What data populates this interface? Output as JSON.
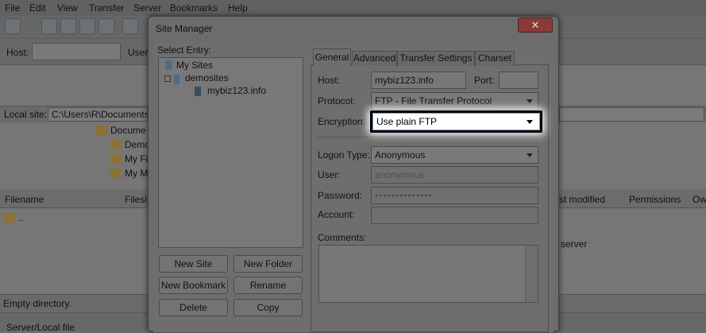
{
  "menubar": {
    "items": [
      "File",
      "Edit",
      "View",
      "Transfer",
      "Server",
      "Bookmarks",
      "Help"
    ]
  },
  "quickconnect": {
    "host_label": "Host:",
    "user_label": "User"
  },
  "local": {
    "site_label": "Local site:",
    "path": "C:\\Users\\R\\Documents\\W",
    "tree_items": [
      "Docume",
      "Demo",
      "My Fi",
      "My M"
    ]
  },
  "file_list": {
    "headers": [
      "Filename",
      "Filesi",
      "st modified",
      "Permissions",
      "Ow"
    ],
    "parent_entry": "..",
    "remote_note": "server",
    "status": "Empty directory."
  },
  "queue": {
    "label": "Server/Local file"
  },
  "dialog": {
    "title": "Site Manager",
    "close_glyph": "✕",
    "select_entry_label": "Select Entry:",
    "tree": {
      "root": "My Sites",
      "folder": "demosites",
      "site": "mybiz123.info"
    },
    "buttons": {
      "new_site": "New Site",
      "new_folder": "New Folder",
      "new_bookmark": "New Bookmark",
      "rename": "Rename",
      "delete": "Delete",
      "copy": "Copy"
    },
    "tabs": [
      "General",
      "Advanced",
      "Transfer Settings",
      "Charset"
    ],
    "general": {
      "host_label": "Host:",
      "host_value": "mybiz123.info",
      "port_label": "Port:",
      "port_value": "",
      "protocol_label": "Protocol:",
      "protocol_value": "FTP - File Transfer Protocol",
      "encryption_label": "Encryption:",
      "encryption_value": "Use plain FTP",
      "logon_label": "Logon Type:",
      "logon_value": "Anonymous",
      "user_label": "User:",
      "user_value": "anonymous",
      "password_label": "Password:",
      "password_value": "••••••••••••••",
      "account_label": "Account:",
      "account_value": "",
      "comments_label": "Comments:"
    }
  }
}
